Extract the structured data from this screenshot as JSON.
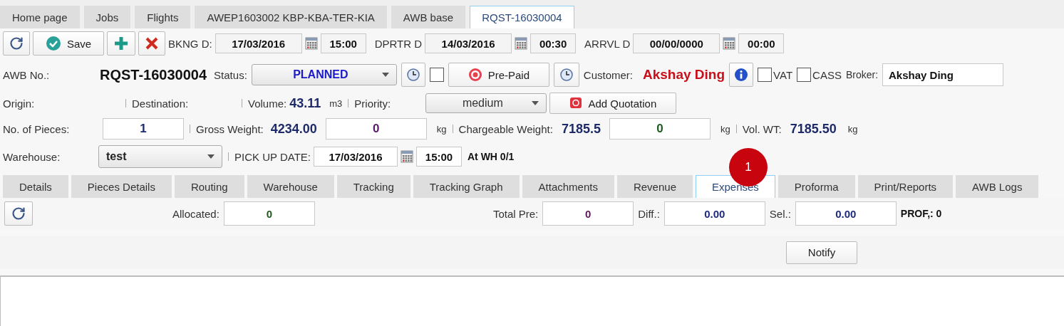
{
  "top_tabs": [
    {
      "label": "Home page",
      "selected": false
    },
    {
      "label": "Jobs",
      "selected": false
    },
    {
      "label": "Flights",
      "selected": false
    },
    {
      "label": "AWEP1603002 KBP-KBA-TER-KIA",
      "selected": false
    },
    {
      "label": "AWB base",
      "selected": false
    },
    {
      "label": "RQST-16030004",
      "selected": true
    }
  ],
  "toolbar": {
    "save_label": "Save",
    "dates": [
      {
        "label": "BKNG D:",
        "date": "17/03/2016",
        "time": "15:00"
      },
      {
        "label": "DPRTR D",
        "date": "14/03/2016",
        "time": "00:30"
      },
      {
        "label": "ARRVL D",
        "date": "00/00/0000",
        "time": "00:00"
      }
    ]
  },
  "awb_row": {
    "awb_label": "AWB No.:",
    "awb_number": "RQST-16030004",
    "status_label": "Status:",
    "status": "PLANNED",
    "prepaid_checked": false,
    "prepaid_label": "Pre-Paid",
    "customer_label": "Customer:",
    "customer": "Akshay Ding",
    "vat": {
      "label": "VAT",
      "checked": false
    },
    "cass": {
      "label": "CASS",
      "checked": false
    },
    "broker_label": "Broker:",
    "broker": "Akshay Ding"
  },
  "origin_row": {
    "origin_label": "Origin:",
    "destination_label": "Destination:",
    "volume_label": "Volume:",
    "volume": "43.11",
    "volume_unit": "m3",
    "priority_label": "Priority:",
    "priority": "medium",
    "quotation_label": "Add Quotation"
  },
  "pieces_row": {
    "pieces_label": "No. of Pieces:",
    "pieces": "1",
    "gross_label": "Gross Weight:",
    "gross": "4234.00",
    "gross_input": "0",
    "gross_unit": "kg",
    "chargeable_label": "Chargeable Weight:",
    "chargeable": "7185.5",
    "chargeable_input": "0",
    "chargeable_unit": "kg",
    "vol_label": "Vol. WT:",
    "vol": "7185.50",
    "vol_unit": "kg"
  },
  "warehouse_row": {
    "warehouse_label": "Warehouse:",
    "warehouse": "test",
    "pickup_label": "PICK UP DATE:",
    "pickup_date": "17/03/2016",
    "pickup_time": "15:00",
    "at_wh": "At WH 0/1"
  },
  "badge": "1",
  "detail_tabs": [
    {
      "label": "Details",
      "selected": false
    },
    {
      "label": "Pieces Details",
      "selected": false
    },
    {
      "label": "Routing",
      "selected": false
    },
    {
      "label": "Warehouse",
      "selected": false
    },
    {
      "label": "Tracking",
      "selected": false
    },
    {
      "label": "Tracking Graph",
      "selected": false
    },
    {
      "label": "Attachments",
      "selected": false
    },
    {
      "label": "Revenue",
      "selected": false
    },
    {
      "label": "Expenses",
      "selected": true
    },
    {
      "label": "Proforma",
      "selected": false
    },
    {
      "label": "Print/Reports",
      "selected": false
    },
    {
      "label": "AWB Logs",
      "selected": false
    }
  ],
  "expenses_bar": {
    "allocated_label": "Allocated:",
    "allocated": "0",
    "total_pre_label": "Total Pre:",
    "total_pre": "0",
    "diff_label": "Diff.:",
    "diff": "0.00",
    "sel_label": "Sel.:",
    "sel": "0.00",
    "prof": "PROF,: 0"
  },
  "notify_label": "Notify"
}
